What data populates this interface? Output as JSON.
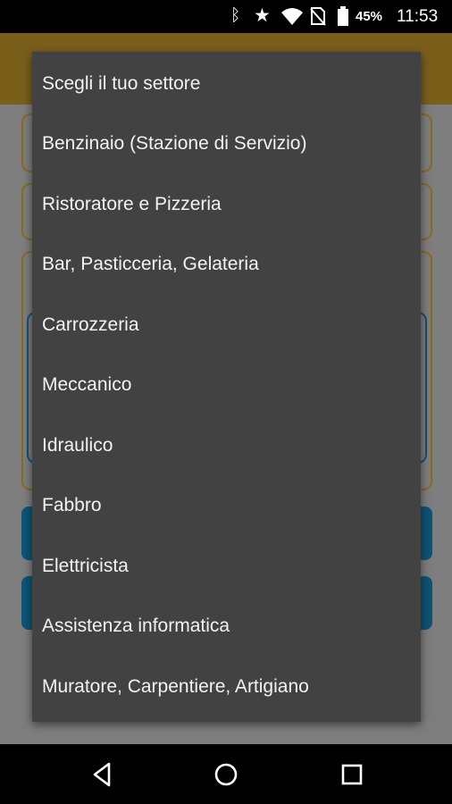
{
  "status_bar": {
    "icons": [
      "bluetooth-icon",
      "star-icon",
      "wifi-icon",
      "no-sim-icon",
      "battery-icon"
    ],
    "battery_percent": "45%",
    "time": "11:53"
  },
  "dropdown": {
    "items": [
      "Scegli il tuo settore",
      "Benzinaio (Stazione di Servizio)",
      "Ristoratore e Pizzeria",
      "Bar, Pasticceria, Gelateria",
      "Carrozzeria",
      "Meccanico",
      "Idraulico",
      "Fabbro",
      "Elettricista",
      "Assistenza informatica",
      "Muratore, Carpentiere, Artigiano"
    ]
  },
  "nav_bar": {
    "buttons": [
      "back-icon",
      "home-icon",
      "recents-icon"
    ]
  },
  "colors": {
    "toolbar": "#7a5f1b",
    "menu_background": "#424242",
    "menu_text": "#f2f2f2",
    "accent_blue": "#0e5476"
  }
}
